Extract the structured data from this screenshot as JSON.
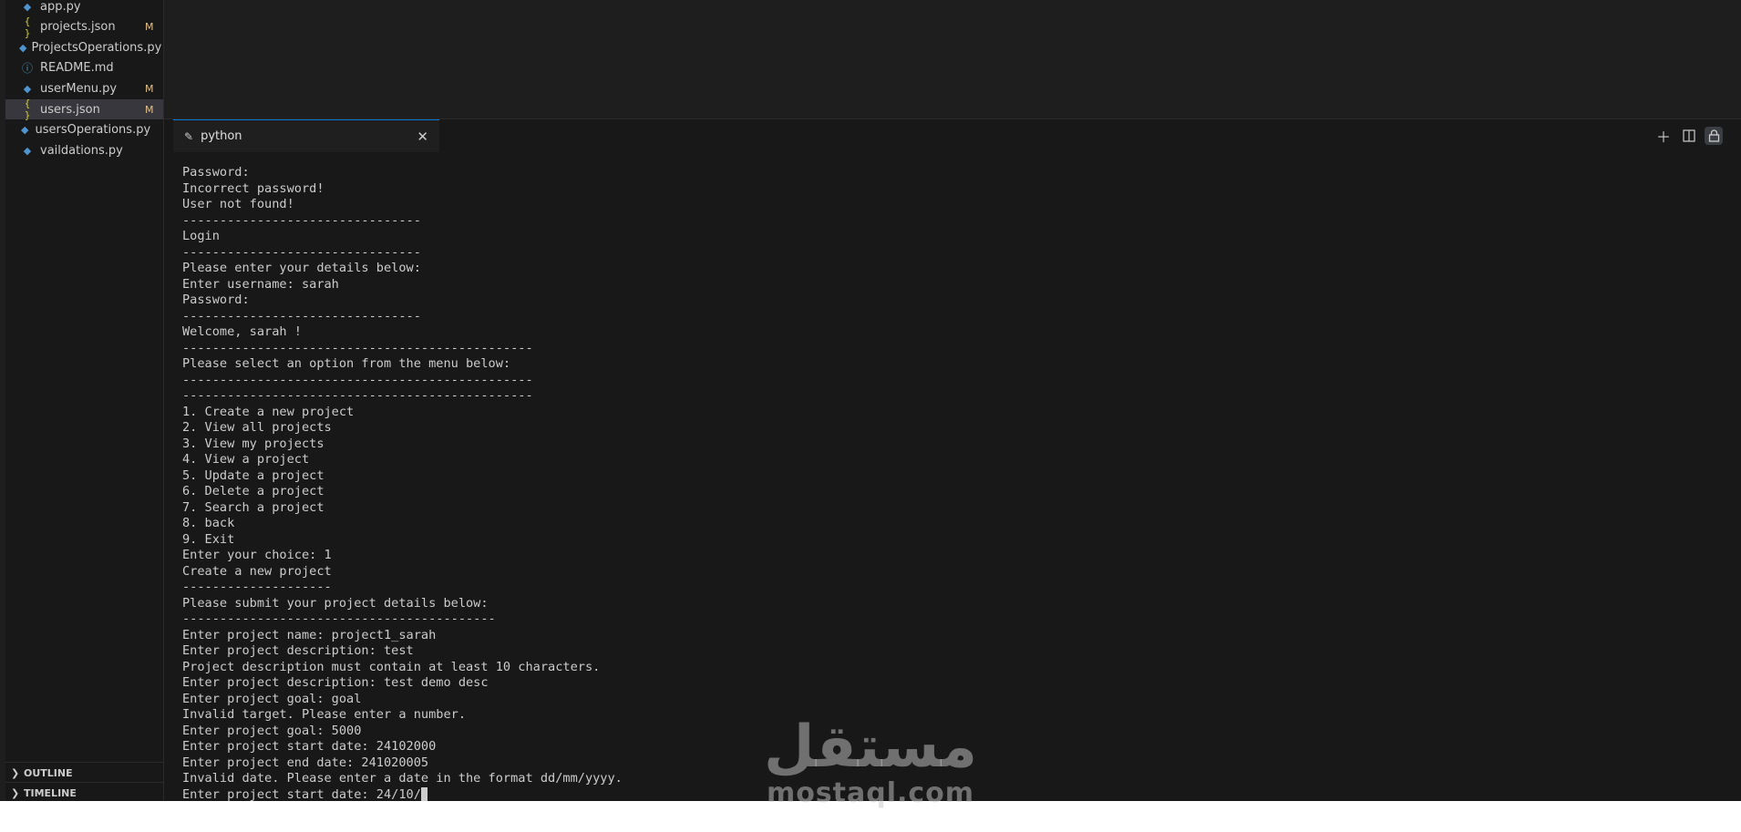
{
  "sidebar": {
    "files": [
      {
        "name": "app.py",
        "icon": "python-file-icon",
        "type": "py",
        "badge": ""
      },
      {
        "name": "projects.json",
        "icon": "json-file-icon",
        "type": "json",
        "badge": "M"
      },
      {
        "name": "ProjectsOperations.py",
        "icon": "python-file-icon",
        "type": "py",
        "badge": ""
      },
      {
        "name": "README.md",
        "icon": "info-icon",
        "type": "info",
        "badge": ""
      },
      {
        "name": "userMenu.py",
        "icon": "python-file-icon",
        "type": "py",
        "badge": "M"
      },
      {
        "name": "users.json",
        "icon": "json-file-icon",
        "type": "json",
        "badge": "M"
      },
      {
        "name": "usersOperations.py",
        "icon": "python-file-icon",
        "type": "py",
        "badge": ""
      },
      {
        "name": "vaildations.py",
        "icon": "python-file-icon",
        "type": "py",
        "badge": ""
      }
    ],
    "outline_label": "OUTLINE",
    "timeline_label": "TIMELINE"
  },
  "terminal": {
    "tab_label": "python",
    "lines": [
      "Password:",
      "Incorrect password!",
      "User not found!",
      "--------------------------------",
      "Login",
      "--------------------------------",
      "Please enter your details below:",
      "Enter username: sarah",
      "Password:",
      "--------------------------------",
      "Welcome, sarah !",
      "-----------------------------------------------",
      "Please select an option from the menu below:",
      "-----------------------------------------------",
      "-----------------------------------------------",
      "1. Create a new project",
      "2. View all projects",
      "3. View my projects",
      "4. View a project",
      "5. Update a project",
      "6. Delete a project",
      "7. Search a project",
      "8. back",
      "9. Exit",
      "Enter your choice: 1",
      "Create a new project",
      "--------------------",
      "Please submit your project details below:",
      "------------------------------------------",
      "Enter project name: project1_sarah",
      "Enter project description: test",
      "Project description must contain at least 10 characters.",
      "Enter project description: test demo desc",
      "Enter project goal: goal",
      "Invalid target. Please enter a number.",
      "Enter project goal: 5000",
      "Enter project start date: 24102000",
      "Enter project end date: 241020005",
      "Invalid date. Please enter a date in the format dd/mm/yyyy.",
      "Enter project start date: 24/10/"
    ]
  },
  "watermark": {
    "arabic": "مستقل",
    "latin": "mostaql.com"
  },
  "colors": {
    "background": "#1e1e1e",
    "sidebar": "#181818",
    "selected": "#37373d",
    "accent": "#0078d4",
    "modified_badge": "#e2c08d"
  }
}
